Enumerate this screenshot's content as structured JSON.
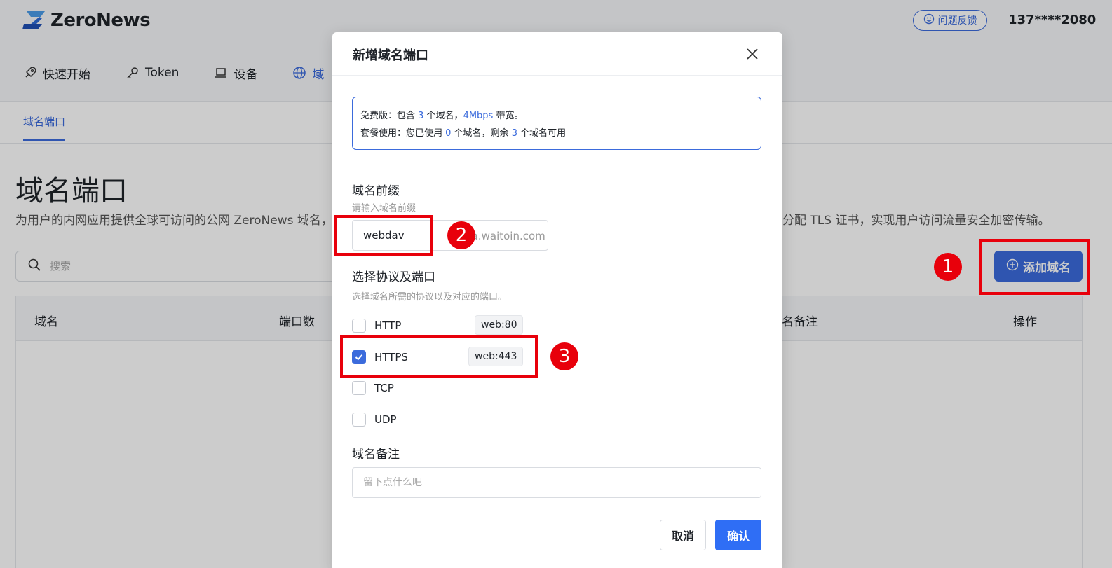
{
  "header": {
    "logo_text": "ZeroNews",
    "feedback_label": "问题反馈",
    "user_phone": "137****2080",
    "accent_color": "#3b6bdc"
  },
  "nav": {
    "items": [
      {
        "label": "快速开始",
        "icon": "rocket-icon"
      },
      {
        "label": "Token",
        "icon": "key-icon"
      },
      {
        "label": "设备",
        "icon": "laptop-icon"
      },
      {
        "label": "域",
        "icon": "globe-icon",
        "active": true
      }
    ]
  },
  "subtabs": {
    "active": "域名端口"
  },
  "page": {
    "title": "域名端口",
    "desc_left": "为用户的内网应用提供全球可访问的公网 ZeroNews 域名，",
    "desc_right": "分配 TLS 证书，实现用户访问流量安全加密传输。",
    "search_placeholder": "搜索",
    "add_domain_label": "添加域名"
  },
  "table": {
    "headers": [
      "域名",
      "端口数",
      "名备注",
      "操作"
    ]
  },
  "modal": {
    "title": "新增域名端口",
    "info": {
      "line1_a": "免费版：包含 ",
      "line1_domains": "3",
      "line1_b": " 个域名，",
      "line1_bw": "4Mbps",
      "line1_c": " 带宽。",
      "line2_a": "套餐使用：您已使用 ",
      "line2_used": "0",
      "line2_b": " 个域名，剩余 ",
      "line2_left": "3",
      "line2_c": " 个域名可用"
    },
    "prefix_label": "域名前缀",
    "prefix_hint": "请输入域名前缀",
    "prefix_value": "webdav",
    "prefix_suffix": ".arpa.waitoin.com",
    "protocol_label": "选择协议及端口",
    "protocol_hint": "选择域名所需的协议以及对应的端口。",
    "protocols": [
      {
        "name": "HTTP",
        "checked": false,
        "tag": "web:80"
      },
      {
        "name": "HTTPS",
        "checked": true,
        "tag": "web:443"
      },
      {
        "name": "TCP",
        "checked": false,
        "tag": ""
      },
      {
        "name": "UDP",
        "checked": false,
        "tag": ""
      }
    ],
    "note_label": "域名备注",
    "note_placeholder": "留下点什么吧",
    "cancel_label": "取消",
    "confirm_label": "确认"
  },
  "annotations": {
    "color": "#e8000b",
    "labels": [
      "1",
      "2",
      "3"
    ]
  }
}
